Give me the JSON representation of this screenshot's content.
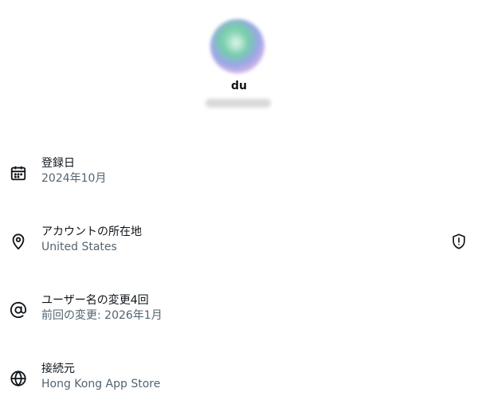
{
  "profile": {
    "display_name": "du"
  },
  "rows": [
    {
      "label": "登録日",
      "value": "2024年10月",
      "icon": "calendar-icon"
    },
    {
      "label": "アカウントの所在地",
      "value": "United States",
      "icon": "location-pin-icon",
      "trailing_icon": "shield-info-icon"
    },
    {
      "label": "ユーザー名の変更4回",
      "value": "前回の変更: 2026年1月",
      "icon": "at-sign-icon"
    },
    {
      "label": "接続元",
      "value": "Hong Kong App Store",
      "icon": "globe-icon"
    }
  ],
  "colors": {
    "text_primary": "#0f1419",
    "text_secondary": "#536471",
    "background": "#ffffff"
  }
}
